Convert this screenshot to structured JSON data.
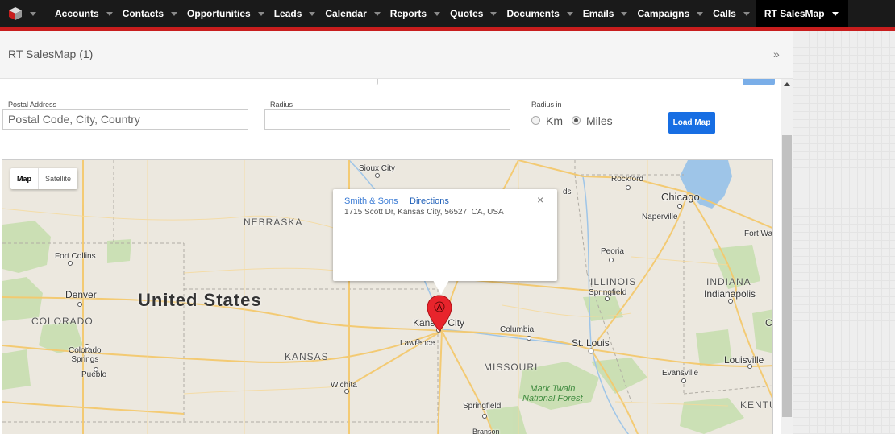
{
  "nav": {
    "items": [
      {
        "label": "Accounts"
      },
      {
        "label": "Contacts"
      },
      {
        "label": "Opportunities"
      },
      {
        "label": "Leads"
      },
      {
        "label": "Calendar"
      },
      {
        "label": "Reports"
      },
      {
        "label": "Quotes"
      },
      {
        "label": "Documents"
      },
      {
        "label": "Emails"
      },
      {
        "label": "Campaigns"
      },
      {
        "label": "Calls"
      }
    ],
    "active": "RT SalesMap",
    "accent_color": "#c81d1d",
    "background_color": "#1a1a1a"
  },
  "dashlet": {
    "title": "RT SalesMap (1)",
    "collapse_icon": "»"
  },
  "form": {
    "postal_label": "Postal Address",
    "postal_placeholder": "Postal Code, City, Country",
    "radius_label": "Radius",
    "radius_value": "",
    "radius_in_label": "Radius in",
    "unit_options": [
      "Km",
      "Miles"
    ],
    "unit_selected": "Miles",
    "load_button": "Load Map",
    "button_color": "#176ee3"
  },
  "map": {
    "type_map": "Map",
    "type_satellite": "Satellite",
    "country_label": "United States",
    "states": [
      "NEBRASKA",
      "COLORADO",
      "KANSAS",
      "MISSOURI",
      "ILLINOIS",
      "INDIANA",
      "KENTU"
    ],
    "cities": {
      "sioux_city": "Sioux City",
      "rockford": "Rockford",
      "chicago": "Chicago",
      "naperville": "Naperville",
      "fort_wayne": "Fort Wa",
      "fort_collins": "Fort Collins",
      "peoria": "Peoria",
      "denver": "Denver",
      "springfield_il": "Springfield",
      "indianapolis": "Indianapolis",
      "kansas_city": "Kansas City",
      "columbia": "Columbia",
      "lawrence": "Lawrence",
      "st_louis": "St. Louis",
      "colorado_springs": "Colorado\nSprings",
      "pueblo": "Pueblo",
      "louisville": "Louisville",
      "evansville": "Evansville",
      "wichita": "Wichita",
      "springfield_mo": "Springfield",
      "branson": "Branson",
      "cedar_rapids_cut": "ds",
      "c_cut": "C"
    },
    "forest": "Mark Twain\nNational Forest",
    "marker_label": "A",
    "marker_color": "#e8242c",
    "infowindow": {
      "name": "Smith & Sons",
      "directions": "Directions",
      "address": "1715 Scott Dr, Kansas City, 56527, CA, USA",
      "close": "×"
    }
  }
}
